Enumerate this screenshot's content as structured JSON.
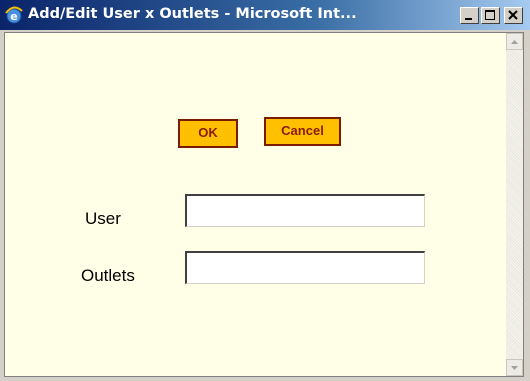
{
  "window": {
    "title": "Add/Edit User x Outlets - Microsoft Int..."
  },
  "actions": {
    "ok_label": "OK",
    "cancel_label": "Cancel"
  },
  "form": {
    "user_label": "User",
    "user_value": "",
    "outlets_label": "Outlets",
    "outlets_value": ""
  },
  "colors": {
    "background": "#fffee6",
    "button_fill": "#ffc000",
    "button_text": "#8b1a00"
  },
  "icons": [
    "ie-icon",
    "minimize-icon",
    "maximize-icon",
    "close-icon",
    "scroll-up-icon",
    "scroll-down-icon"
  ]
}
